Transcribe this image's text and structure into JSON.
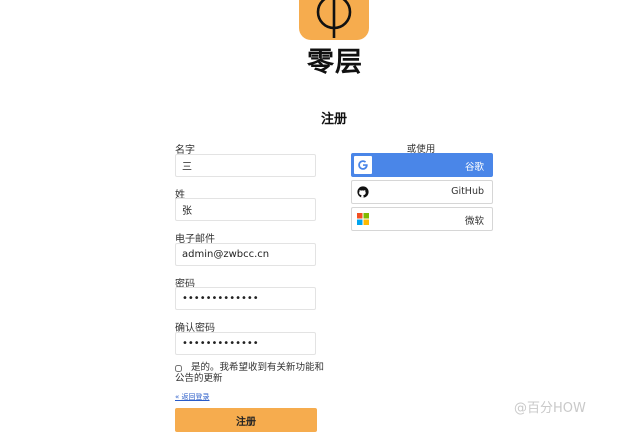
{
  "brand": {
    "name": "零层"
  },
  "page_title": "注册",
  "form": {
    "fields": [
      {
        "label": "名字",
        "value": "三"
      },
      {
        "label": "姓",
        "value": "张"
      },
      {
        "label": "电子邮件",
        "value": "admin@zwbcc.cn"
      },
      {
        "label": "密码",
        "value": "•••••••••••••"
      },
      {
        "label": "确认密码",
        "value": "•••••••••••••"
      }
    ],
    "consent_text": "是的。我希望收到有关新功能和公告的更新",
    "back_link": "« 返回登录",
    "submit_label": "注册"
  },
  "social": {
    "heading": "或使用",
    "buttons": [
      {
        "label": "谷歌",
        "icon": "google-icon",
        "color": "#4a86e8"
      },
      {
        "label": "GitHub",
        "icon": "github-icon"
      },
      {
        "label": "微软",
        "icon": "microsoft-icon"
      }
    ]
  },
  "watermark": "@百分HOW",
  "colors": {
    "accent": "#f6ac4e",
    "google": "#4a86e8"
  }
}
